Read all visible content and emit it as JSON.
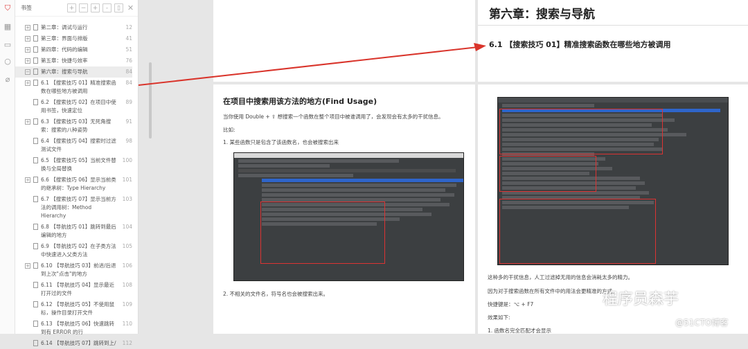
{
  "sidebar": {
    "title": "书签",
    "icons": [
      "bookmark-icon",
      "thumbnails-icon",
      "comment-icon",
      "search-icon",
      "attachment-icon"
    ],
    "items": [
      {
        "label": "第二章：调试与运行",
        "page": "12",
        "level": 1,
        "expand": "+"
      },
      {
        "label": "第三章：界面与排版",
        "page": "41",
        "level": 1,
        "expand": "+"
      },
      {
        "label": "第四章：代码的编辑",
        "page": "51",
        "level": 1,
        "expand": "+"
      },
      {
        "label": "第五章：快捷与效率",
        "page": "76",
        "level": 1,
        "expand": "+"
      },
      {
        "label": "第六章：搜索与导航",
        "page": "84",
        "level": 1,
        "expand": "−"
      },
      {
        "label": "6.1 【搜索技巧 01】精准搜索函数在哪些地方被调用",
        "page": "84",
        "level": 2,
        "expand": "+"
      },
      {
        "label": "6.2 【搜索技巧 02】在项目中使用书签，快速定位",
        "page": "89",
        "level": 2,
        "expand": ""
      },
      {
        "label": "6.3 【搜索技巧 03】无死角搜索：搜索的八种姿势",
        "page": "91",
        "level": 2,
        "expand": "+"
      },
      {
        "label": "6.4 【搜索技巧 04】搜索时过滤测试文件",
        "page": "98",
        "level": 2,
        "expand": ""
      },
      {
        "label": "6.5 【搜索技巧 05】当前文件替换与全局替换",
        "page": "100",
        "level": 2,
        "expand": ""
      },
      {
        "label": "6.6 【搜索技巧 06】显示当前类的继承树：Type Hierarchy",
        "page": "101",
        "level": 2,
        "expand": "+"
      },
      {
        "label": "6.7 【搜索技巧 07】显示当前方法的调用树：Method Hierarchy",
        "page": "103",
        "level": 2,
        "expand": ""
      },
      {
        "label": "6.8 【导航技巧 01】跳转到最后编辑的地方",
        "page": "104",
        "level": 2,
        "expand": ""
      },
      {
        "label": "6.9 【导航技巧 02】在子类方法中快速进入父类方法",
        "page": "105",
        "level": 2,
        "expand": ""
      },
      {
        "label": "6.10 【导航技巧 03】前进/后退到上次\"点击\"的地方",
        "page": "106",
        "level": 2,
        "expand": "+"
      },
      {
        "label": "6.11 【导航技巧 04】显示最近打开过的文件",
        "page": "108",
        "level": 2,
        "expand": ""
      },
      {
        "label": "6.12 【导航技巧 05】不使用鼠标，操作目录打开文件",
        "page": "109",
        "level": 2,
        "expand": ""
      },
      {
        "label": "6.13 【导航技巧 06】快速跳转到有 ERROR 的行",
        "page": "110",
        "level": 2,
        "expand": ""
      },
      {
        "label": "6.14 【导航技巧 07】跳转到上/",
        "page": "112",
        "level": 2,
        "expand": ""
      }
    ]
  },
  "doc": {
    "chapter_title": "第六章：搜索与导航",
    "section_title": "6.1 【搜索技巧 01】精准搜索函数在哪些地方被调用",
    "find_usage_title": "在项目中搜索用该方法的地方(Find Usage)",
    "para1": "当你使用 Double + ⇧ 想搜索一个函数在整个项目中被谁调用了，会发现会有太多的干扰信息。",
    "para2": "比如:",
    "list1": "1. 某些函数只是包含了该函数名，也会被搜索出来",
    "list2": "2. 不相关的文件名，符号名也会被搜索出来。",
    "right1": "这种多的干扰信息，人工过滤掉无用的信息会消耗太多的精力。",
    "right2": "因为对于搜索函数在所有文件中的用法会更精准的方式。",
    "shortcut": "快捷键是：⌥ + F7",
    "effect": "效果如下:",
    "list3": "1. 函数名完全匹配才会显示"
  },
  "watermark": {
    "wechat": "程序员森芋",
    "site": "@51CTO博客"
  },
  "colors": {
    "arrow": "#d9342b",
    "selection": "#ececec"
  }
}
